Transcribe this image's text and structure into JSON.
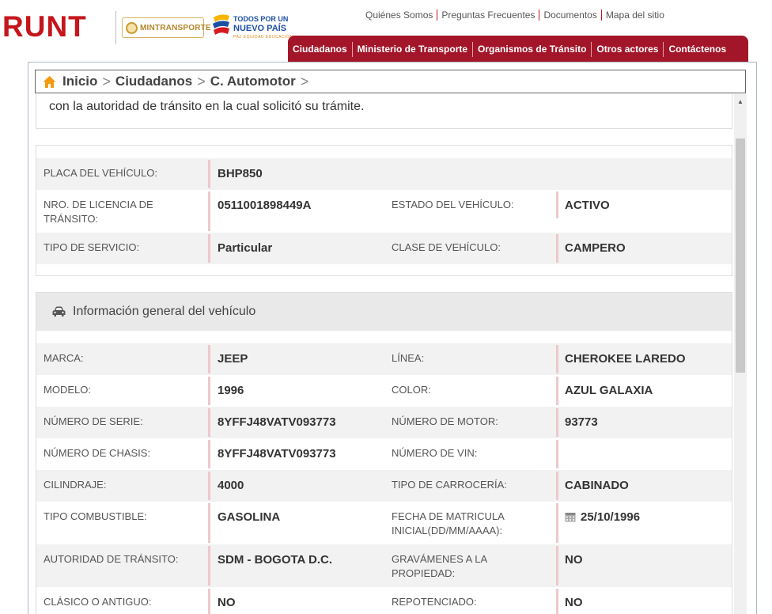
{
  "brand": {
    "runt_logo": "RUNT",
    "mintransporte_logo": "MINTRANSPORTE",
    "nuevopais_line1": "TODOS POR UN",
    "nuevopais_line2": "NUEVO PAÍS",
    "nuevopais_line3": "PAZ  EQUIDAD  EDUCACIÓN"
  },
  "top_links": [
    "Quiénes Somos",
    "Preguntas Frecuentes",
    "Documentos",
    "Mapa del sitio"
  ],
  "nav": [
    "Ciudadanos",
    "Ministerio de Transporte",
    "Organismos de Tránsito",
    "Otros actores",
    "Contáctenos"
  ],
  "breadcrumb": [
    "Inicio",
    "Ciudadanos",
    "C. Automotor"
  ],
  "notice_text": "con la autoridad de tránsito en la cual solicitó su trámite.",
  "summary": {
    "placa_label": "PLACA DEL VEHÍCULO:",
    "placa_value": "BHP850",
    "licencia_label": "NRO. DE LICENCIA DE TRÁNSITO:",
    "licencia_value": "0511001898449A",
    "estado_label": "ESTADO DEL VEHÍCULO:",
    "estado_value": "ACTIVO",
    "servicio_label": "TIPO DE SERVICIO:",
    "servicio_value": "Particular",
    "clase_label": "CLASE DE VEHÍCULO:",
    "clase_value": "CAMPERO"
  },
  "general": {
    "title": "Información general del vehículo",
    "rows": [
      {
        "l1": "MARCA:",
        "v1": "JEEP",
        "l2": "LÍNEA:",
        "v2": "CHEROKEE LAREDO"
      },
      {
        "l1": "MODELO:",
        "v1": "1996",
        "l2": "COLOR:",
        "v2": "AZUL GALAXIA"
      },
      {
        "l1": "NÚMERO DE SERIE:",
        "v1": "8YFFJ48VATV093773",
        "l2": "NÚMERO DE MOTOR:",
        "v2": "93773"
      },
      {
        "l1": "NÚMERO DE CHASIS:",
        "v1": "8YFFJ48VATV093773",
        "l2": "NÚMERO DE VIN:",
        "v2": ""
      },
      {
        "l1": "CILINDRAJE:",
        "v1": "4000",
        "l2": "TIPO DE CARROCERÍA:",
        "v2": "CABINADO"
      },
      {
        "l1": "TIPO COMBUSTIBLE:",
        "v1": "GASOLINA",
        "l2": "FECHA DE MATRICULA INICIAL(DD/MM/AAAA):",
        "v2": "25/10/1996"
      },
      {
        "l1": "AUTORIDAD DE TRÁNSITO:",
        "v1": "SDM - BOGOTA D.C.",
        "l2": "GRAVÁMENES A LA PROPIEDAD:",
        "v2": "NO"
      },
      {
        "l1": "CLÁSICO O ANTIGUO:",
        "v1": "NO",
        "l2": "REPOTENCIADO:",
        "v2": "NO"
      }
    ]
  },
  "colors": {
    "brand_red": "#c4161c",
    "nav_red": "#a3162a",
    "value_divider": "#ecc8cc"
  }
}
